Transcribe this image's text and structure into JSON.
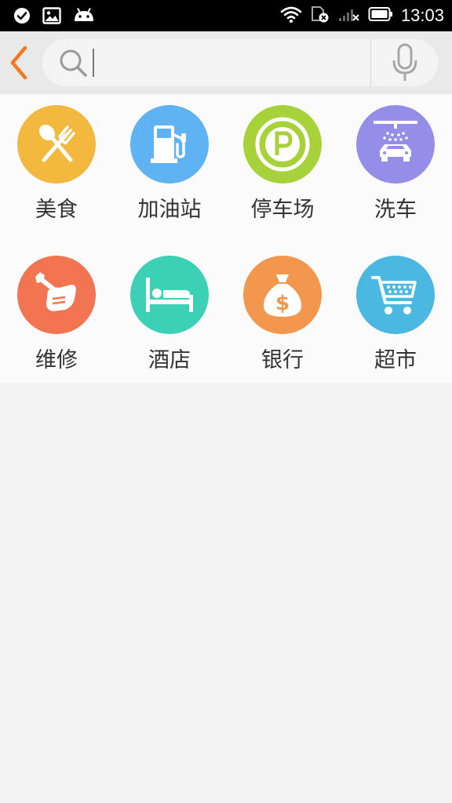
{
  "status_bar": {
    "time": "13:03",
    "left_icons": [
      "check-circle-icon",
      "image-icon",
      "android-icon"
    ],
    "right_icons": [
      "wifi-icon",
      "sim-error-icon",
      "signal-no-service-icon",
      "battery-icon"
    ]
  },
  "search": {
    "back_icon": "chevron-left-icon",
    "search_icon": "magnifier-icon",
    "value": "",
    "placeholder": "",
    "mic_icon": "microphone-icon"
  },
  "colors": {
    "accent": "#f07a24",
    "food": "#f2b93e",
    "gas": "#5fb3f2",
    "parking": "#a8d23a",
    "car_wash": "#958ee9",
    "repair": "#f27450",
    "hotel": "#3cd0b5",
    "bank": "#f2974d",
    "supermarket": "#4ab8e0"
  },
  "categories": [
    {
      "label": "美食",
      "icon": "fork-spoon-icon"
    },
    {
      "label": "加油站",
      "icon": "fuel-pump-icon"
    },
    {
      "label": "停车场",
      "icon": "parking-icon"
    },
    {
      "label": "洗车",
      "icon": "car-wash-icon"
    },
    {
      "label": "维修",
      "icon": "wrench-hand-icon"
    },
    {
      "label": "酒店",
      "icon": "bed-icon"
    },
    {
      "label": "银行",
      "icon": "money-bag-icon"
    },
    {
      "label": "超市",
      "icon": "shopping-cart-icon"
    }
  ]
}
